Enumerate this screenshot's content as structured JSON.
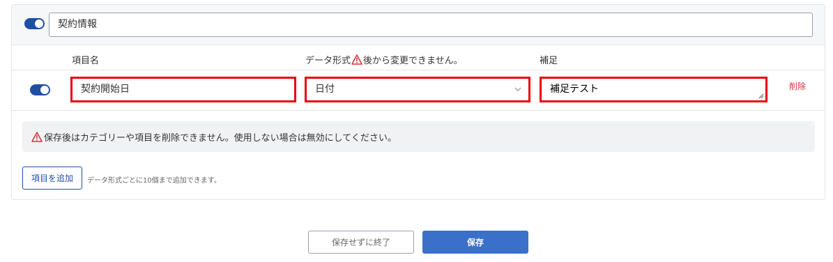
{
  "category": {
    "enabled": true,
    "name_value": "契約情報"
  },
  "columns": {
    "item_name": "項目名",
    "data_format": "データ形式",
    "data_format_warning": "後から変更できません。",
    "supplement": "補足"
  },
  "item_row": {
    "enabled": true,
    "name_value": "契約開始日",
    "format_value": "日付",
    "supplement_value": "補足テスト",
    "delete_label": "削除"
  },
  "notice": {
    "text": "保存後はカテゴリーや項目を削除できません。使用しない場合は無効にしてください。"
  },
  "add": {
    "button_label": "項目を追加",
    "hint": "データ形式ごとに10個まで追加できます。"
  },
  "footer": {
    "exit_label": "保存せずに終了",
    "save_label": "保存"
  },
  "colors": {
    "accent": "#1f4fa3",
    "save": "#3a70c9",
    "highlight_border": "#e8000b",
    "warning": "#d9363e"
  },
  "icons": {
    "warning": "warning-triangle-icon",
    "dropdown": "chevron-down-icon"
  }
}
